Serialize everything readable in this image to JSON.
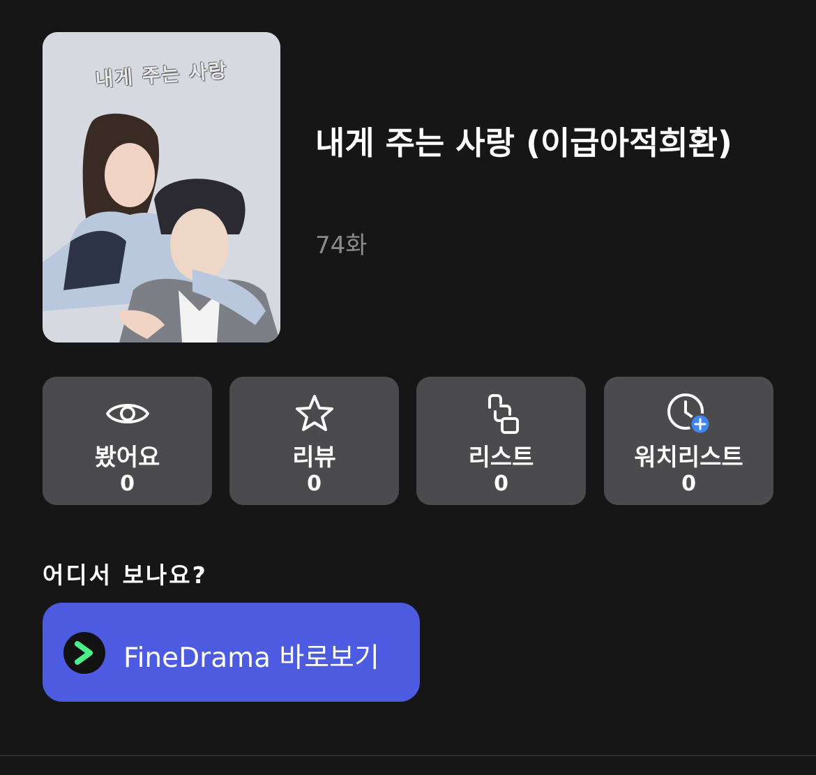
{
  "poster": {
    "overlay_text": "내게 주는 사랑"
  },
  "drama": {
    "title": "내게 주는 사랑 (이급아적희환)",
    "episodes": "74화"
  },
  "stats": [
    {
      "label": "봤어요",
      "count": "0",
      "icon": "eye-icon"
    },
    {
      "label": "리뷰",
      "count": "0",
      "icon": "star-icon"
    },
    {
      "label": "리스트",
      "count": "0",
      "icon": "list-link-icon"
    },
    {
      "label": "워치리스트",
      "count": "0",
      "icon": "clock-plus-icon"
    }
  ],
  "where": {
    "heading": "어디서 보나요?",
    "provider_button": "FineDrama 바로보기",
    "provider_icon": "play-chevron-icon"
  },
  "colors": {
    "background": "#161617",
    "card": "#4b4b4d",
    "button": "#4c5be0",
    "accent_blue": "#3f86f0",
    "logo_green": "#4cf08a"
  }
}
